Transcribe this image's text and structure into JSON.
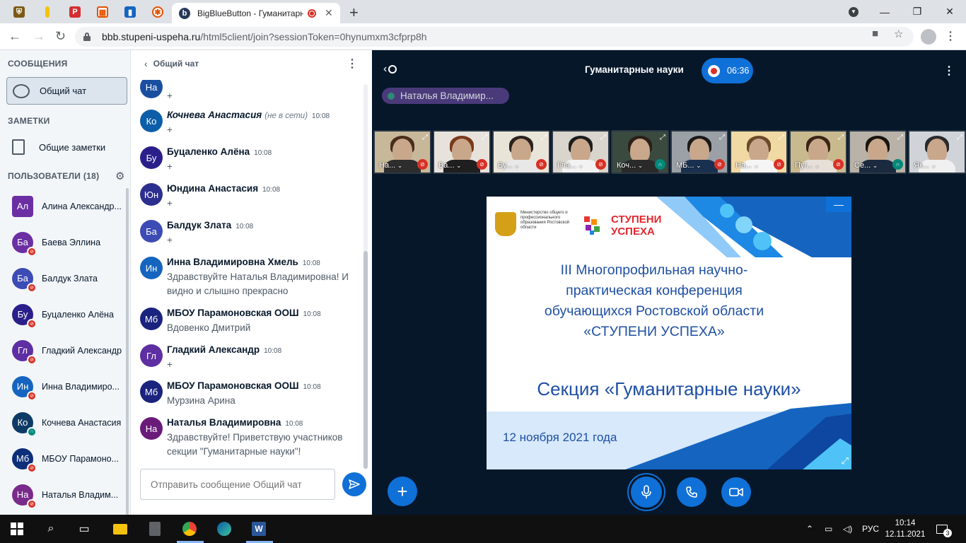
{
  "browser": {
    "active_tab_title": "BigBlueButton - Гуманитарн",
    "url_host": "bbb.stupeni-uspeha.ru",
    "url_path": "/html5client/join?sessionToken=0hynumxm3cfprp8h"
  },
  "leftnav": {
    "messages_title": "СООБЩЕНИЯ",
    "public_chat_label": "Общий чат",
    "notes_title": "ЗАМЕТКИ",
    "shared_notes_label": "Общие заметки",
    "users_title": "ПОЛЬЗОВАТЕЛИ (18)",
    "users": [
      {
        "initials": "Ал",
        "name": "Алина Александр...",
        "color": "#6b2fa3",
        "status": "none"
      },
      {
        "initials": "Ба",
        "name": "Баева Эллина",
        "color": "#6b2fa3",
        "status": "muted"
      },
      {
        "initials": "Ба",
        "name": "Балдук Злата",
        "color": "#3d4bb5",
        "status": "muted"
      },
      {
        "initials": "Бу",
        "name": "Буцаленко Алёна",
        "color": "#2a1f8a",
        "status": "muted"
      },
      {
        "initials": "Гл",
        "name": "Гладкий Александр",
        "color": "#5e2fa3",
        "status": "muted"
      },
      {
        "initials": "Ин",
        "name": "Инна Владимиро...",
        "color": "#1565c0",
        "status": "muted"
      },
      {
        "initials": "Ко",
        "name": "Кочнева Анастасия",
        "color": "#0d3b66",
        "status": "listen"
      },
      {
        "initials": "Мб",
        "name": "МБОУ Парамоно...",
        "color": "#0d2e7a",
        "status": "muted"
      },
      {
        "initials": "На",
        "name": "Наталья Владим...",
        "color": "#7a2a8a",
        "status": "muted"
      }
    ]
  },
  "chat": {
    "title": "Общий чат",
    "input_placeholder": "Отправить сообщение Общий чат",
    "messages": [
      {
        "initials": "На",
        "color": "#1a4fa0",
        "author": "",
        "time": "",
        "text": "+",
        "offline": ""
      },
      {
        "initials": "Ко",
        "color": "#0d5ea8",
        "author": "Кочнева Анастасия",
        "time": "10:08",
        "text": "+",
        "offline": "(не в сети)"
      },
      {
        "initials": "Бу",
        "color": "#2a1f8a",
        "author": "Буцаленко Алёна",
        "time": "10:08",
        "text": "+",
        "offline": ""
      },
      {
        "initials": "Юн",
        "color": "#2d2f8f",
        "author": "Юндина Анастасия",
        "time": "10:08",
        "text": "+",
        "offline": ""
      },
      {
        "initials": "Ба",
        "color": "#3d4bb5",
        "author": "Балдук Злата",
        "time": "10:08",
        "text": "+",
        "offline": ""
      },
      {
        "initials": "Ин",
        "color": "#1565c0",
        "author": "Инна Владимировна Хмель",
        "time": "10:08",
        "text": "Здравствуйте Наталья Владимировна! И видно и слышно прекрасно",
        "offline": ""
      },
      {
        "initials": "Мб",
        "color": "#1a237e",
        "author": "МБОУ Парамоновская ООШ",
        "time": "10:08",
        "text": "Вдовенко Дмитрий",
        "offline": ""
      },
      {
        "initials": "Гл",
        "color": "#5e2fa3",
        "author": "Гладкий Александр",
        "time": "10:08",
        "text": "+",
        "offline": ""
      },
      {
        "initials": "Мб",
        "color": "#1a237e",
        "author": "МБОУ Парамоновская ООШ",
        "time": "10:08",
        "text": "Мурзина Арина",
        "offline": ""
      },
      {
        "initials": "На",
        "color": "#6a1b7a",
        "author": "Наталья Владимировна",
        "time": "10:08",
        "text": "Здравствуйте! Приветствую участников секции \"Гуманитарные науки\"!",
        "offline": ""
      }
    ]
  },
  "meeting": {
    "title": "Гуманитарные науки",
    "rec_time": "06:36",
    "talker": "Наталья Владимир...",
    "videos": [
      {
        "label": "На...",
        "mic": "muted"
      },
      {
        "label": "Ба...",
        "mic": "muted"
      },
      {
        "label": "Бу...",
        "mic": "muted"
      },
      {
        "label": "Гла...",
        "mic": "muted"
      },
      {
        "label": "Коч...",
        "mic": "listen"
      },
      {
        "label": "МБ...",
        "mic": "muted"
      },
      {
        "label": "На...",
        "mic": "muted"
      },
      {
        "label": "Пуг...",
        "mic": "muted"
      },
      {
        "label": "Се...",
        "mic": "listen"
      },
      {
        "label": "Як...",
        "mic": "none"
      }
    ],
    "slide": {
      "ministry": "Министерство общего и профессионального образования Ростовской области",
      "brand_line1": "СТУПЕНИ",
      "brand_line2": "УСПЕХА",
      "heading_line1": "III Многопрофильная научно-",
      "heading_line2": "практическая конференция",
      "heading_line3": "обучающихся Ростовской области",
      "heading_line4": "«СТУПЕНИ УСПЕХА»",
      "section": "Секция «Гуманитарные науки»",
      "date": "12 ноября 2021 года"
    }
  },
  "taskbar": {
    "lang": "РУС",
    "time": "10:14",
    "date": "12.11.2021",
    "notif_count": "3"
  },
  "colors": {
    "bbb_blue": "#0f70d7",
    "bbb_dark": "#06172a",
    "muted_red": "#d93025",
    "listen_teal": "#00897b"
  }
}
